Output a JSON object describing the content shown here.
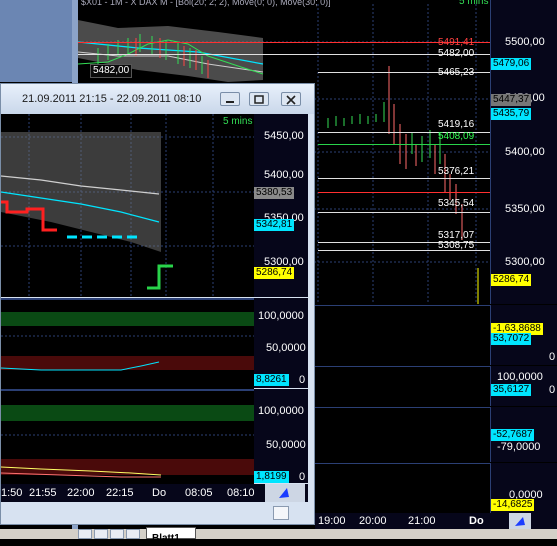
{
  "back_window": {
    "header_text": "$X01 - 1M - X DAX M - [Bol(20; 2; 2), Move(0; 0), Move(30; 0)]",
    "interval": "5 mins",
    "mini_tag": "5482,00",
    "price_axis": [
      "5500,00",
      "5450,00",
      "5400,00",
      "5350,00",
      "5300,00"
    ],
    "line_labels": [
      "5491,41",
      "5482,00",
      "5465,23",
      "5419,16",
      "5408,09",
      "5376,21",
      "5345,54",
      "5317,07",
      "5308,75"
    ],
    "price_tags": [
      "5479,06",
      "5447,37",
      "5435,79",
      "5286,74"
    ],
    "indicator1_tags": [
      "-1,63,8688",
      "53,7072",
      "0"
    ],
    "indicator2_tags": [
      "100,0000",
      "35,6127",
      "0"
    ],
    "indicator3_tags": [
      "-52,7687",
      "-79,0000"
    ],
    "indicator4_tags": [
      "0,0000",
      "-14,6825"
    ],
    "time_axis": [
      "19:00",
      "20:00",
      "21:00",
      "Do"
    ],
    "sheet_tab": "Blatt1"
  },
  "front_window": {
    "title": "21.09.2011 21:15 - 22.09.2011 08:10",
    "interval": "5 mins",
    "price_axis": [
      "5450,00",
      "5400,00",
      "5350,00",
      "5300,00"
    ],
    "price_tags": [
      "5380,53",
      "5342,81",
      "5286,74"
    ],
    "panel1": {
      "axis": [
        "100,0000",
        "50,0000",
        "0"
      ],
      "tag": "8,8261"
    },
    "panel2": {
      "axis": [
        "100,0000",
        "50,0000",
        "0"
      ],
      "tag": "1,8199"
    },
    "time_axis": [
      "1:50",
      "21:55",
      "22:00",
      "22:15",
      "Do",
      "08:05",
      "08:10"
    ]
  },
  "colors": {
    "chart_bg": "#000000",
    "grid": "#2b3f74",
    "axis_bg": "#06061a",
    "green_band": "#0a4a14",
    "red_band": "#4a0a0a",
    "cyan": "#00e5ff",
    "yellow_tag": "#ffff00",
    "red_line": "#ff2020",
    "green_line": "#29d34a",
    "title_bar": "#d7e2f1"
  },
  "icons": [
    "minimize-icon",
    "maximize-icon",
    "close-icon",
    "cursor-arrow-icon"
  ]
}
